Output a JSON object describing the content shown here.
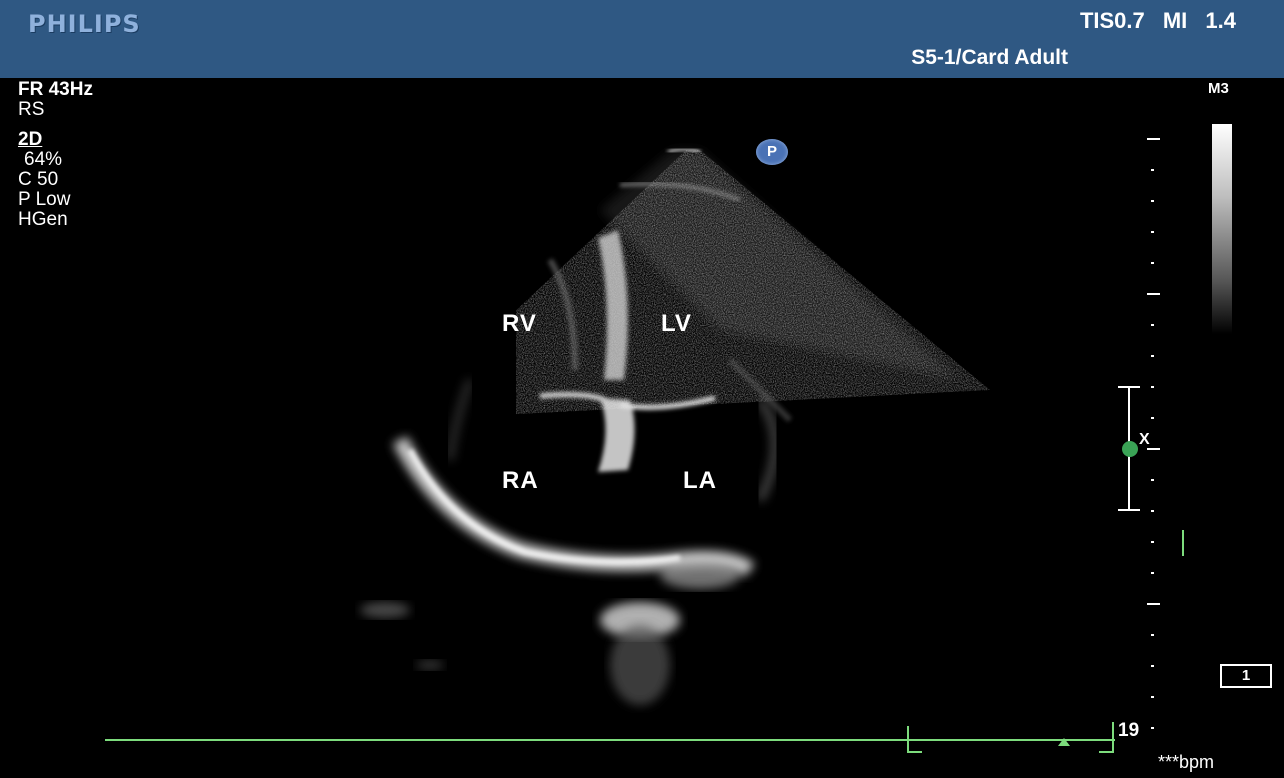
{
  "header": {
    "brand": "PHILIPS",
    "safety_indices": "TIS0.7 MI 1.4",
    "probe_preset": "S5-1/Card Adult"
  },
  "params": {
    "frame_rate": "FR 43Hz",
    "mode_flag": "RS",
    "mode": "2D",
    "gain": "64%",
    "compression": "C 50",
    "power": "P Low",
    "frequency": "HGen"
  },
  "map_label": "M3",
  "chambers": {
    "rv": "RV",
    "lv": "LV",
    "ra": "RA",
    "la": "LA"
  },
  "orientation_marker": "P",
  "focus_marker": "X",
  "depth_value": "19",
  "heart_rate": "***bpm",
  "screen_number": "1",
  "colors": {
    "header_bg": "#2f5883",
    "ecg_trace": "#7ddc7d",
    "focus_dot": "#3aa356"
  }
}
